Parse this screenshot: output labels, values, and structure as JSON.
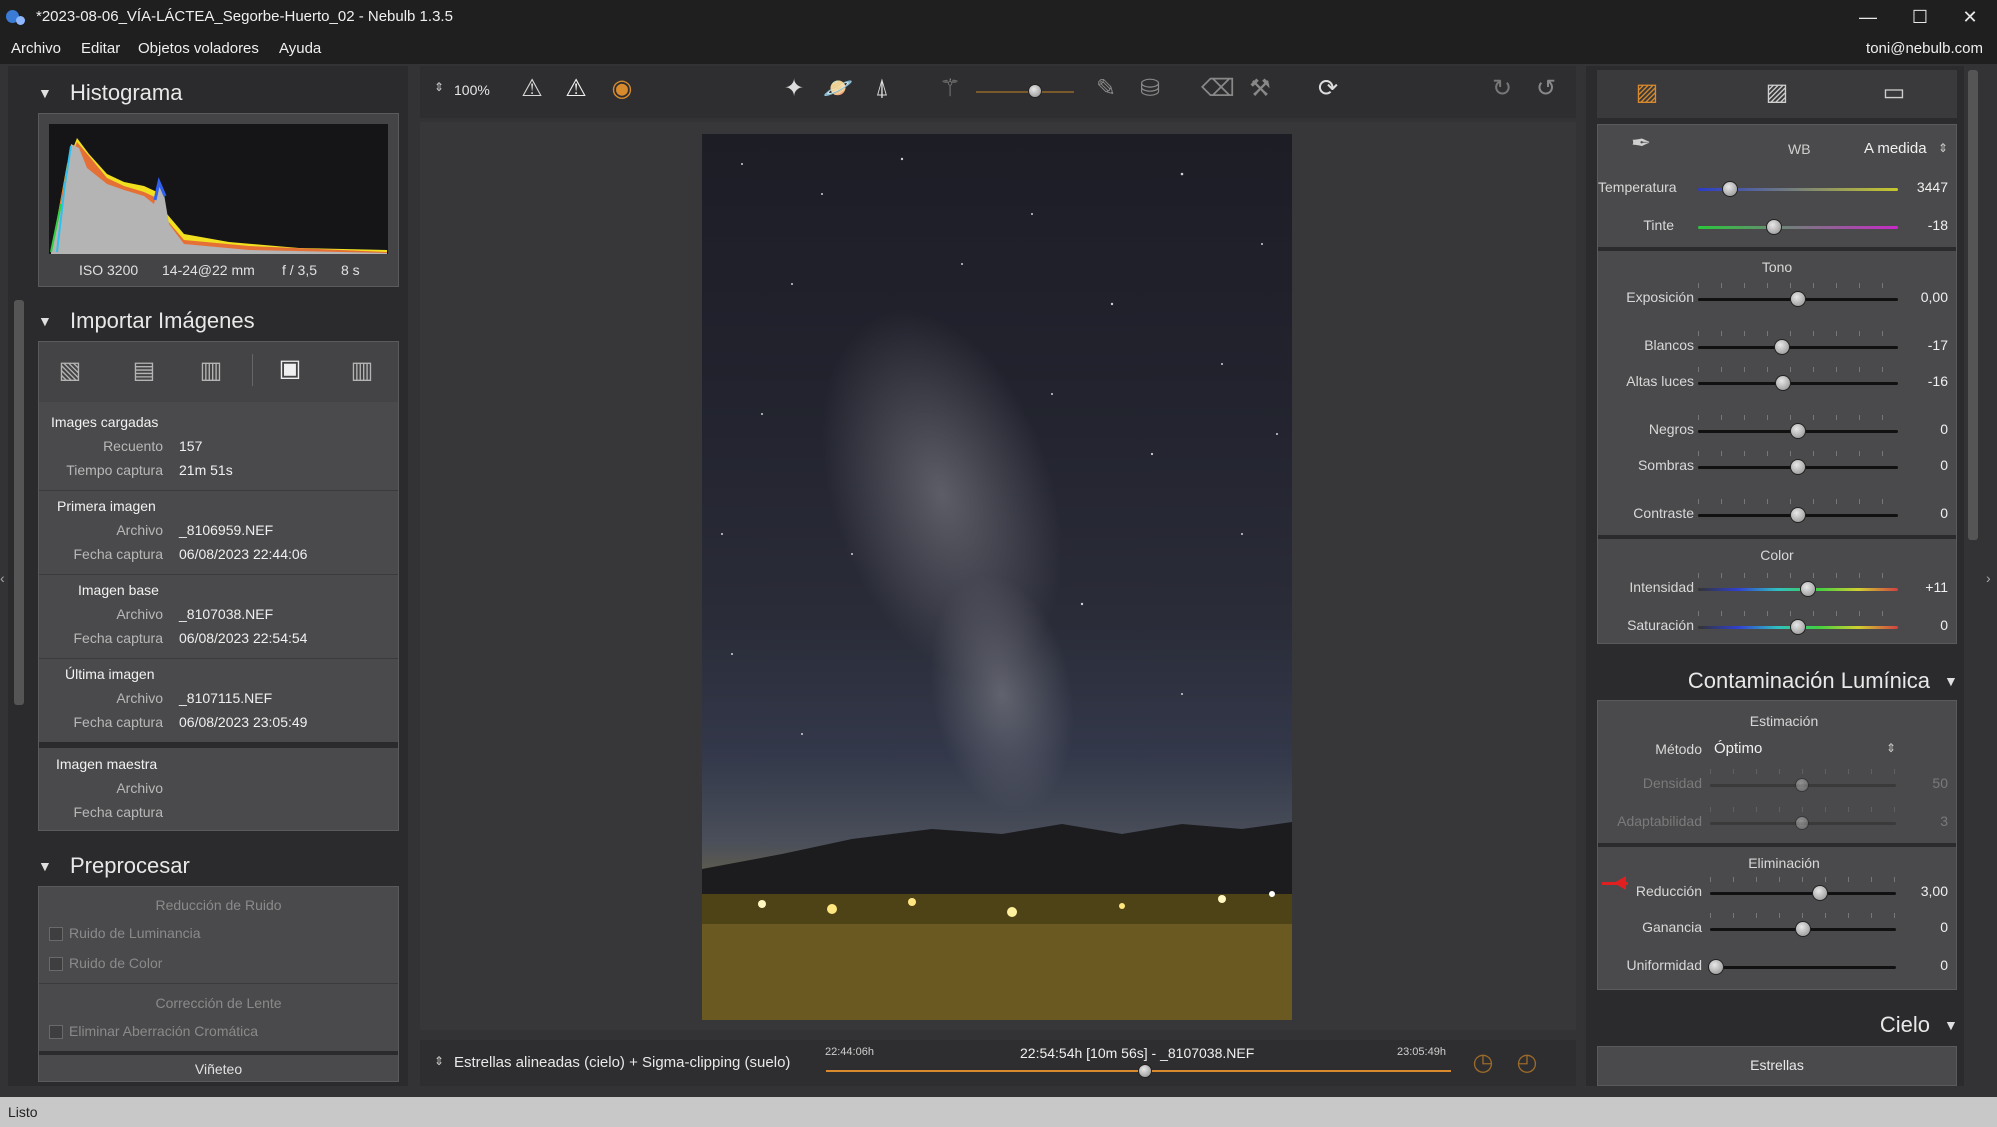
{
  "window": {
    "title": "*2023-08-06_VÍA-LÁCTEA_Segorbe-Huerto_02 - Nebulb 1.3.5",
    "controls": [
      "—",
      "☐",
      "✕"
    ]
  },
  "menu": {
    "items": [
      "Archivo",
      "Editar",
      "Objetos voladores",
      "Ayuda"
    ],
    "user": "toni@nebulb.com"
  },
  "histogram": {
    "title": "Histograma",
    "iso": "ISO 3200",
    "lens": "14-24@22 mm",
    "aperture": "f / 3,5",
    "shutter": "8 s"
  },
  "import": {
    "title": "Importar Imágenes",
    "icons": [
      "add-images-icon",
      "add-folder-icon",
      "remove-images-icon",
      "image-view-icon",
      "clear-list-icon"
    ],
    "loaded": {
      "heading": "Images cargadas",
      "count_label": "Recuento",
      "count": "157",
      "time_label": "Tiempo captura",
      "time": "21m 51s"
    },
    "first": {
      "heading": "Primera imagen",
      "file_label": "Archivo",
      "file": "_8106959.NEF",
      "date_label": "Fecha captura",
      "date": "06/08/2023 22:44:06"
    },
    "base": {
      "heading": "Imagen base",
      "file_label": "Archivo",
      "file": "_8107038.NEF",
      "date_label": "Fecha captura",
      "date": "06/08/2023 22:54:54"
    },
    "last": {
      "heading": "Última imagen",
      "file_label": "Archivo",
      "file": "_8107115.NEF",
      "date_label": "Fecha captura",
      "date": "06/08/2023 23:05:49"
    },
    "master": {
      "heading": "Imagen maestra",
      "file_label": "Archivo",
      "date_label": "Fecha captura"
    }
  },
  "preprocess": {
    "title": "Preprocesar",
    "noise_heading": "Reducción de Ruido",
    "luminance": "Ruido de Luminancia",
    "color": "Ruido de Color",
    "lens_heading": "Corrección de Lente",
    "aberration": "Eliminar Aberración Cromática",
    "vignette": "Viñeteo"
  },
  "toolbar": {
    "zoom": "100%"
  },
  "status_bar": {
    "stack_mode": "Estrellas alineadas (cielo) + Sigma-clipping (suelo)",
    "time_start": "22:44:06h",
    "current": "22:54:54h [10m 56s] - _8107038.NEF",
    "time_end": "23:05:49h",
    "timeline_position": 0.51
  },
  "statusline": {
    "text": "Listo"
  },
  "adjust": {
    "wb_label": "WB",
    "wb_value": "A medida",
    "temperature_label": "Temperatura",
    "temperature": "3447",
    "tint_label": "Tinte",
    "tint": "-18",
    "tone_heading": "Tono",
    "exposure_label": "Exposición",
    "exposure": "0,00",
    "whites_label": "Blancos",
    "whites": "-17",
    "highlights_label": "Altas luces",
    "highlights": "-16",
    "blacks_label": "Negros",
    "blacks": "0",
    "shadows_label": "Sombras",
    "shadows": "0",
    "contrast_label": "Contraste",
    "contrast": "0",
    "color_heading": "Color",
    "intensity_label": "Intensidad",
    "intensity": "+11",
    "saturation_label": "Saturación",
    "saturation": "0"
  },
  "light_pollution": {
    "title": "Contaminación Lumínica",
    "estimation_heading": "Estimación",
    "method_label": "Método",
    "method": "Óptimo",
    "density_label": "Densidad",
    "density": "50",
    "adaptability_label": "Adaptabilidad",
    "adaptability": "3",
    "elimination_heading": "Eliminación",
    "reduction_label": "Reducción",
    "reduction": "3,00",
    "gain_label": "Ganancia",
    "gain": "0",
    "uniformity_label": "Uniformidad",
    "uniformity": "0"
  },
  "sky": {
    "title": "Cielo",
    "stars": "Estrellas"
  },
  "colors": {
    "accent": "#d88a2c",
    "panel": "#2b2b2d",
    "box": "#4a4a4c"
  }
}
